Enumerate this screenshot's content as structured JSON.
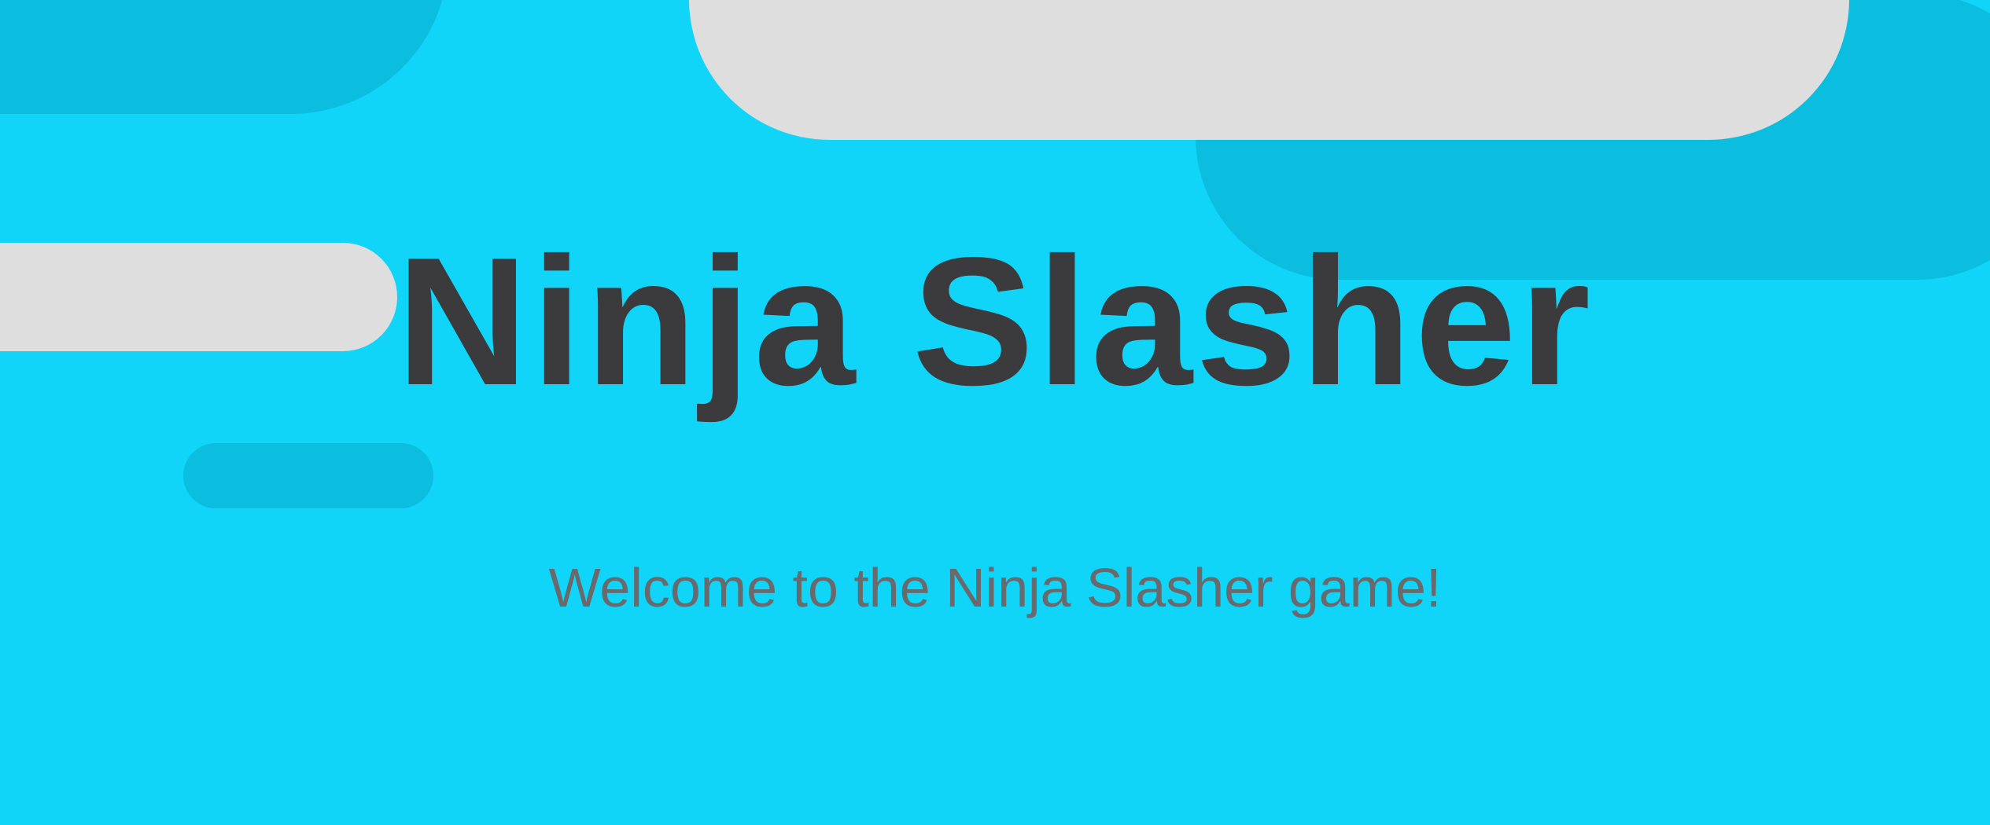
{
  "game": {
    "title": "Ninja Slasher",
    "welcome_text": "Welcome to the Ninja Slasher game!"
  },
  "colors": {
    "background": "#10d5f8",
    "cloud_dark": "#0bbddf",
    "cloud_light": "#dedede",
    "title_text": "#3b3b3d",
    "subtitle_text": "#6a6a6c"
  }
}
